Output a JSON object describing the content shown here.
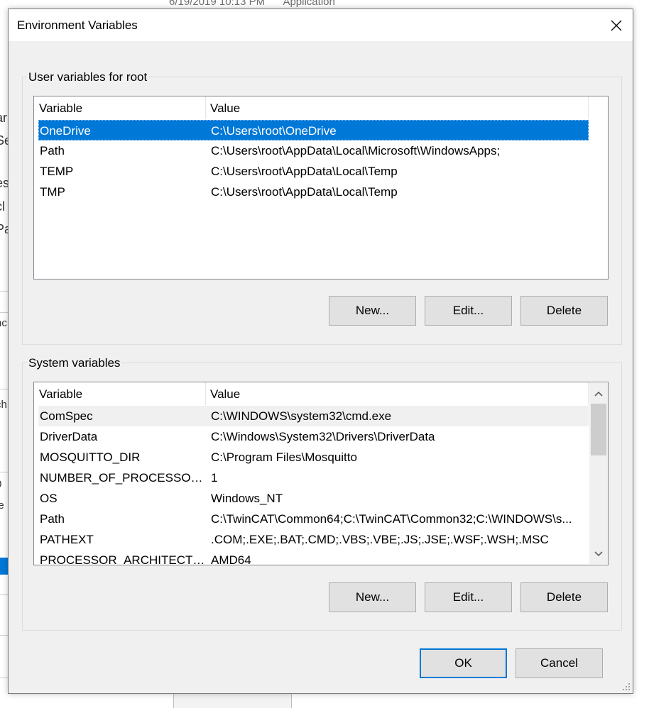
{
  "background": {
    "top_texts": [
      "6/19/2019 10:13 PM",
      "Application"
    ]
  },
  "dialog": {
    "title": "Environment Variables",
    "user_group": {
      "label": "User variables for root",
      "columns": [
        "Variable",
        "Value"
      ],
      "rows": [
        {
          "variable": "OneDrive",
          "value": "C:\\Users\\root\\OneDrive",
          "selected": true
        },
        {
          "variable": "Path",
          "value": "C:\\Users\\root\\AppData\\Local\\Microsoft\\WindowsApps;"
        },
        {
          "variable": "TEMP",
          "value": "C:\\Users\\root\\AppData\\Local\\Temp"
        },
        {
          "variable": "TMP",
          "value": "C:\\Users\\root\\AppData\\Local\\Temp"
        }
      ],
      "buttons": {
        "new": "New...",
        "edit": "Edit...",
        "delete": "Delete"
      }
    },
    "system_group": {
      "label": "System variables",
      "columns": [
        "Variable",
        "Value"
      ],
      "rows": [
        {
          "variable": "ComSpec",
          "value": "C:\\WINDOWS\\system32\\cmd.exe",
          "highlighted": true
        },
        {
          "variable": "DriverData",
          "value": "C:\\Windows\\System32\\Drivers\\DriverData"
        },
        {
          "variable": "MOSQUITTO_DIR",
          "value": "C:\\Program Files\\Mosquitto"
        },
        {
          "variable": "NUMBER_OF_PROCESSORS",
          "value": "1"
        },
        {
          "variable": "OS",
          "value": "Windows_NT"
        },
        {
          "variable": "Path",
          "value": "C:\\TwinCAT\\Common64;C:\\TwinCAT\\Common32;C:\\WINDOWS\\s..."
        },
        {
          "variable": "PATHEXT",
          "value": ".COM;.EXE;.BAT;.CMD;.VBS;.VBE;.JS;.JSE;.WSF;.WSH;.MSC"
        },
        {
          "variable": "PROCESSOR_ARCHITECTURE",
          "value": "AMD64"
        }
      ],
      "buttons": {
        "new": "New...",
        "edit": "Edit...",
        "delete": "Delete"
      }
    },
    "ok_label": "OK",
    "cancel_label": "Cancel"
  },
  "colors": {
    "selection": "#0078d7",
    "dialog_bg": "#f0f0f0",
    "button_bg": "#e1e1e1"
  },
  "icons": [
    "close-icon",
    "scroll-up-icon",
    "scroll-down-icon",
    "resize-grip-icon"
  ]
}
